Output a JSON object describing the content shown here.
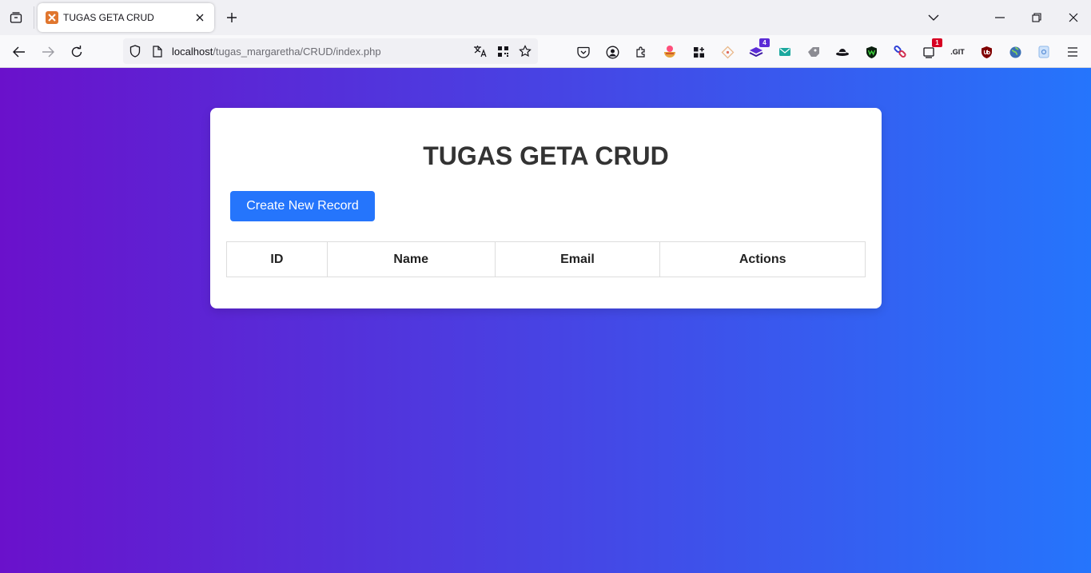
{
  "browser": {
    "tab": {
      "title": "TUGAS GETA CRUD",
      "favicon": "xampp-icon"
    },
    "url": {
      "host": "localhost",
      "path": "/tugas_margaretha/CRUD/index.php"
    },
    "extensions": [
      {
        "name": "pocket-icon"
      },
      {
        "name": "account-icon"
      },
      {
        "name": "extensions-icon"
      },
      {
        "name": "food-extension-icon"
      },
      {
        "name": "apps-grid-icon"
      },
      {
        "name": "diamond-extension-icon"
      },
      {
        "name": "stack-extension-icon",
        "badge": "4"
      },
      {
        "name": "mail-extension-icon"
      },
      {
        "name": "puzzle-extension-icon"
      },
      {
        "name": "hat-extension-icon"
      },
      {
        "name": "shield-w-icon"
      },
      {
        "name": "link-extension-icon"
      },
      {
        "name": "notify-extension-icon",
        "badge": "1"
      },
      {
        "name": "git-extension-icon",
        "text": ".GIT"
      },
      {
        "name": "ublock-icon"
      },
      {
        "name": "globe-extension-icon"
      },
      {
        "name": "page-extension-icon"
      }
    ]
  },
  "page": {
    "title": "TUGAS GETA CRUD",
    "create_button": "Create New Record",
    "table": {
      "headers": [
        "ID",
        "Name",
        "Email",
        "Actions"
      ],
      "rows": []
    }
  },
  "colors": {
    "gradient_start": "#6a11cb",
    "gradient_end": "#2575fc",
    "button": "#2575fc"
  }
}
